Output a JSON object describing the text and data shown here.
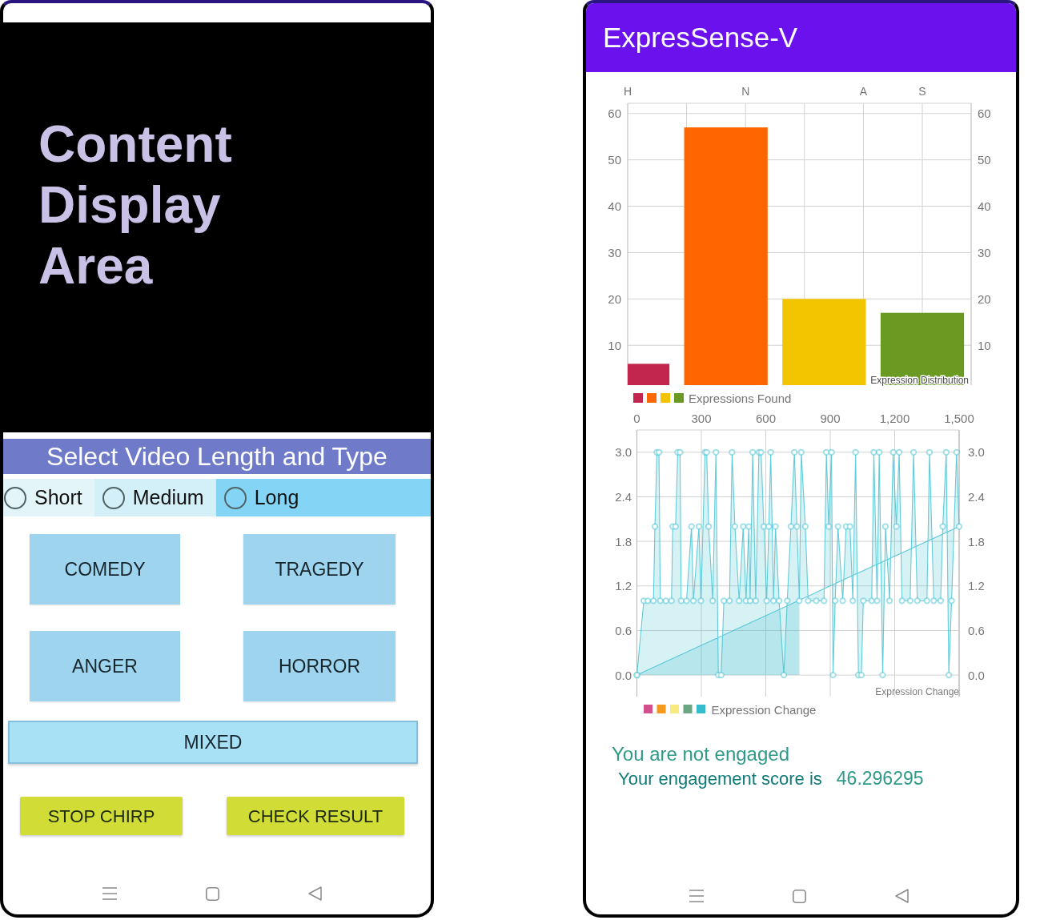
{
  "left_screen": {
    "content_area": {
      "text": "Content Display Area"
    },
    "header": {
      "title": "Select Video Length and Type"
    },
    "length_options": [
      {
        "label": "Short",
        "selected": false,
        "color": "#e4f5fa"
      },
      {
        "label": "Medium",
        "selected": false,
        "color": "#d3eff8"
      },
      {
        "label": "Long",
        "selected": false,
        "color": "#84d4f5"
      }
    ],
    "genre_buttons": [
      {
        "label": "COMEDY"
      },
      {
        "label": "TRAGEDY"
      },
      {
        "label": "ANGER"
      },
      {
        "label": "HORROR"
      }
    ],
    "mixed_button": {
      "label": "MIXED"
    },
    "action_buttons": [
      {
        "label": "STOP CHIRP"
      },
      {
        "label": "CHECK RESULT"
      }
    ]
  },
  "right_screen": {
    "app_bar": {
      "title": "ExpresSense-V"
    },
    "distribution_chart": {
      "chart_data": {
        "type": "bar",
        "title": "Expression Distribution",
        "categories": [
          "H",
          "N",
          "A",
          "S"
        ],
        "series": [
          {
            "name": "Expressions Found",
            "colors": [
              "#c2264f",
              "#ff6600",
              "#f2c500",
              "#6b9a23"
            ],
            "values": [
              6,
              57,
              20,
              17
            ]
          }
        ],
        "ylim": [
          1.4,
          62.2
        ],
        "yticks": [
          10,
          20,
          30,
          40,
          50,
          60
        ],
        "grid": true,
        "annotations": [
          "10",
          "20",
          "30",
          "40",
          "50",
          "60"
        ]
      }
    },
    "change_chart": {
      "chart_data": {
        "type": "area",
        "title": "Expression Change",
        "x": [
          0,
          32,
          51,
          77,
          84,
          93,
          103,
          109,
          135,
          161,
          167,
          180,
          190,
          201,
          206,
          231,
          254,
          263,
          289,
          298,
          317,
          325,
          334,
          353,
          368,
          379,
          392,
          405,
          431,
          443,
          456,
          476,
          495,
          508,
          521,
          527,
          539,
          553,
          568,
          578,
          591,
          604,
          614,
          623,
          636,
          645,
          662,
          684,
          700,
          717,
          733,
          745,
          756,
          765,
          784,
          797,
          835,
          871,
          882,
          893,
          906,
          913,
          923,
          936,
          958,
          974,
          992,
          1005,
          1018,
          1031,
          1045,
          1054,
          1093,
          1103,
          1118,
          1128,
          1144,
          1157,
          1176,
          1193,
          1208,
          1221,
          1234,
          1272,
          1288,
          1305,
          1350,
          1362,
          1382,
          1414,
          1424,
          1440,
          1452,
          1465,
          1488,
          1500,
          0
        ],
        "series": [
          {
            "name": "Expression Change",
            "color": "#35bccf",
            "marker": "circle",
            "values": [
              0,
              1,
              1,
              1,
              2,
              3,
              3,
              1,
              1,
              1,
              2,
              2,
              3,
              3,
              1,
              1,
              2,
              1,
              2,
              1,
              3,
              3,
              2,
              1,
              3,
              0,
              0,
              1,
              1,
              3,
              2,
              1,
              2,
              1,
              2,
              1,
              3,
              1,
              3,
              3,
              2,
              1,
              2,
              3,
              1,
              2,
              1,
              0,
              1,
              2,
              3,
              2,
              1,
              3,
              2,
              1,
              1,
              1,
              3,
              2,
              3,
              0,
              1,
              2,
              1,
              2,
              2,
              1,
              3,
              0,
              0,
              1,
              1,
              3,
              1,
              3,
              0,
              2,
              1,
              3,
              2,
              3,
              1,
              1,
              3,
              1,
              1,
              3,
              1,
              1,
              2,
              3,
              0,
              1,
              3,
              2,
              0
            ]
          }
        ],
        "xlim": [
          0,
          1500
        ],
        "ylim": [
          -0.29,
          3.3
        ],
        "grid": true,
        "xticks": [
          0,
          300,
          600,
          900,
          {
            "value": 1200,
            "label": "1,200"
          },
          {
            "value": 1500,
            "label": "1,500"
          }
        ],
        "yticks": [
          {
            "value": 0,
            "label": "0.0"
          },
          {
            "value": 0.6,
            "label": "0.6"
          },
          {
            "value": 1.2,
            "label": "1.2"
          },
          {
            "value": 1.8,
            "label": "1.8"
          },
          {
            "value": 2.4,
            "label": "2.4"
          },
          {
            "value": 3,
            "label": "3.0"
          }
        ],
        "annotations": [
          "0.0",
          "0.6",
          "1.2",
          "1.8",
          "2.4",
          "3.0"
        ]
      },
      "legend": {
        "swatches": [
          {
            "color": "#d4508c"
          },
          {
            "color": "#f59a1c"
          },
          {
            "color": "#f8ea7c"
          },
          {
            "color": "#6aa682"
          },
          {
            "color": "#35bccf"
          }
        ]
      }
    },
    "result": {
      "message": "You are not engaged",
      "score_label": "Your engagement score is",
      "score": "46.296295"
    }
  }
}
